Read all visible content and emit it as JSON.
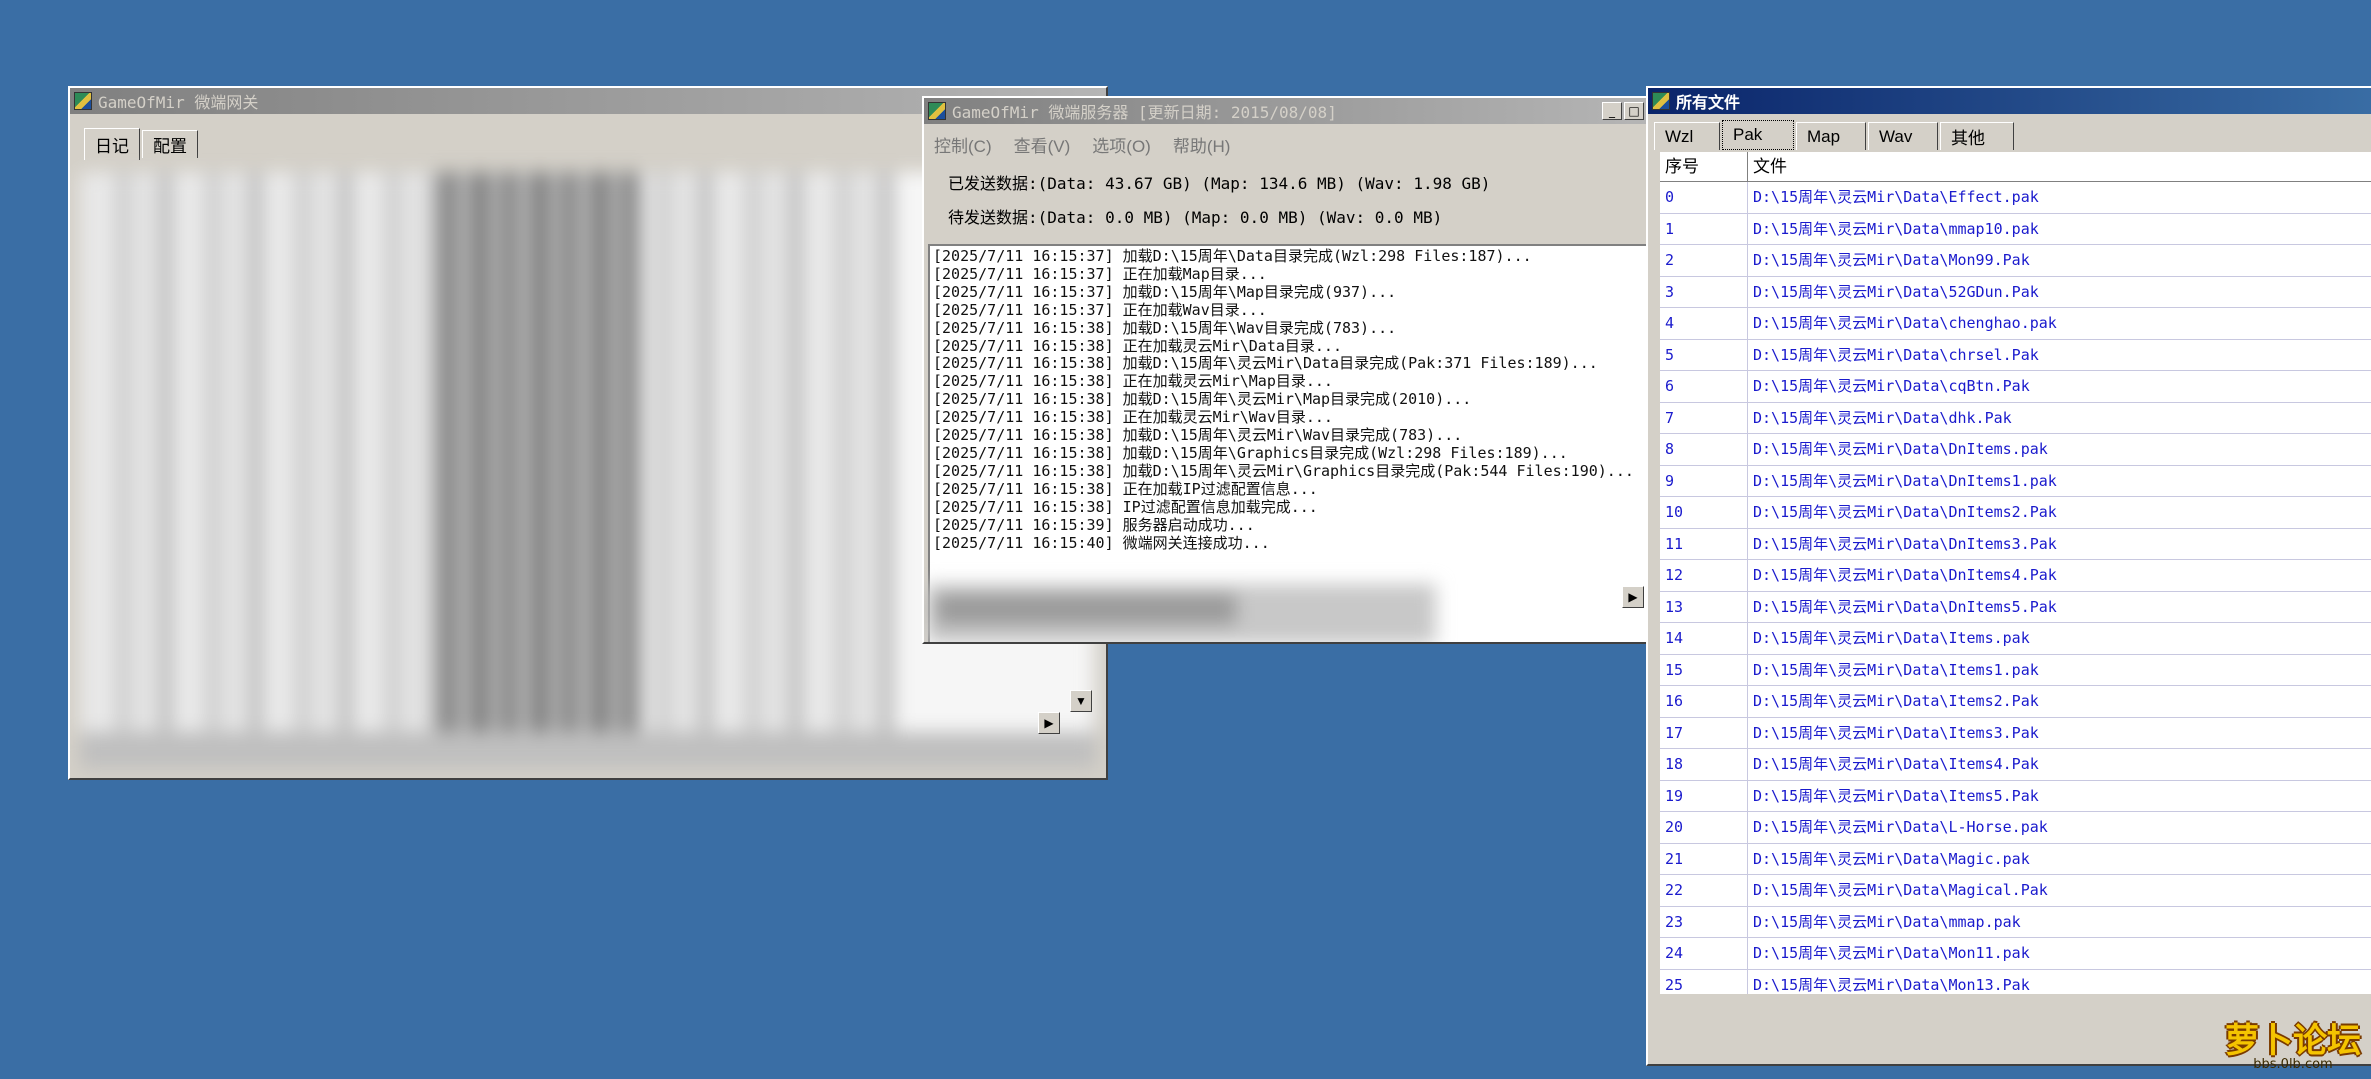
{
  "gateway_window": {
    "title": "GameOfMir 微端网关",
    "tabs": [
      "日记",
      "配置"
    ]
  },
  "server_window": {
    "title": "GameOfMir 微端服务器 [更新日期: 2015/08/08]",
    "menu": [
      "控制(C)",
      "查看(V)",
      "选项(O)",
      "帮助(H)"
    ],
    "sent_stats": "已发送数据:(Data: 43.67 GB) (Map: 134.6 MB) (Wav: 1.98 GB)",
    "pending_stats": "待发送数据:(Data: 0.0 MB) (Map: 0.0 MB) (Wav: 0.0 MB)",
    "log": [
      "[2025/7/11 16:15:37] 加载D:\\15周年\\Data目录完成(Wzl:298 Files:187)...",
      "[2025/7/11 16:15:37] 正在加载Map目录...",
      "[2025/7/11 16:15:37] 加载D:\\15周年\\Map目录完成(937)...",
      "[2025/7/11 16:15:37] 正在加载Wav目录...",
      "[2025/7/11 16:15:38] 加载D:\\15周年\\Wav目录完成(783)...",
      "[2025/7/11 16:15:38] 正在加载灵云Mir\\Data目录...",
      "[2025/7/11 16:15:38] 加载D:\\15周年\\灵云Mir\\Data目录完成(Pak:371 Files:189)...",
      "[2025/7/11 16:15:38] 正在加载灵云Mir\\Map目录...",
      "[2025/7/11 16:15:38] 加载D:\\15周年\\灵云Mir\\Map目录完成(2010)...",
      "[2025/7/11 16:15:38] 正在加载灵云Mir\\Wav目录...",
      "[2025/7/11 16:15:38] 加载D:\\15周年\\灵云Mir\\Wav目录完成(783)...",
      "[2025/7/11 16:15:38] 加载D:\\15周年\\Graphics目录完成(Wzl:298 Files:189)...",
      "[2025/7/11 16:15:38] 加载D:\\15周年\\灵云Mir\\Graphics目录完成(Pak:544 Files:190)...",
      "[2025/7/11 16:15:38] 正在加载IP过滤配置信息...",
      "[2025/7/11 16:15:38] IP过滤配置信息加载完成...",
      "[2025/7/11 16:15:39] 服务器启动成功...",
      "[2025/7/11 16:15:40] 微端网关连接成功..."
    ]
  },
  "files_window": {
    "title": "所有文件",
    "tabs": [
      "Wzl",
      "Pak",
      "Map",
      "Wav",
      "其他"
    ],
    "selected_tab": "Pak",
    "columns": [
      "序号",
      "文件"
    ],
    "rows": [
      {
        "index": "0",
        "file": "D:\\15周年\\灵云Mir\\Data\\Effect.pak"
      },
      {
        "index": "1",
        "file": "D:\\15周年\\灵云Mir\\Data\\mmap10.pak"
      },
      {
        "index": "2",
        "file": "D:\\15周年\\灵云Mir\\Data\\Mon99.Pak"
      },
      {
        "index": "3",
        "file": "D:\\15周年\\灵云Mir\\Data\\52GDun.Pak"
      },
      {
        "index": "4",
        "file": "D:\\15周年\\灵云Mir\\Data\\chenghao.pak"
      },
      {
        "index": "5",
        "file": "D:\\15周年\\灵云Mir\\Data\\chrsel.Pak"
      },
      {
        "index": "6",
        "file": "D:\\15周年\\灵云Mir\\Data\\cqBtn.Pak"
      },
      {
        "index": "7",
        "file": "D:\\15周年\\灵云Mir\\Data\\dhk.Pak"
      },
      {
        "index": "8",
        "file": "D:\\15周年\\灵云Mir\\Data\\DnItems.pak"
      },
      {
        "index": "9",
        "file": "D:\\15周年\\灵云Mir\\Data\\DnItems1.pak"
      },
      {
        "index": "10",
        "file": "D:\\15周年\\灵云Mir\\Data\\DnItems2.Pak"
      },
      {
        "index": "11",
        "file": "D:\\15周年\\灵云Mir\\Data\\DnItems3.Pak"
      },
      {
        "index": "12",
        "file": "D:\\15周年\\灵云Mir\\Data\\DnItems4.Pak"
      },
      {
        "index": "13",
        "file": "D:\\15周年\\灵云Mir\\Data\\DnItems5.Pak"
      },
      {
        "index": "14",
        "file": "D:\\15周年\\灵云Mir\\Data\\Items.pak"
      },
      {
        "index": "15",
        "file": "D:\\15周年\\灵云Mir\\Data\\Items1.pak"
      },
      {
        "index": "16",
        "file": "D:\\15周年\\灵云Mir\\Data\\Items2.Pak"
      },
      {
        "index": "17",
        "file": "D:\\15周年\\灵云Mir\\Data\\Items3.Pak"
      },
      {
        "index": "18",
        "file": "D:\\15周年\\灵云Mir\\Data\\Items4.Pak"
      },
      {
        "index": "19",
        "file": "D:\\15周年\\灵云Mir\\Data\\Items5.Pak"
      },
      {
        "index": "20",
        "file": "D:\\15周年\\灵云Mir\\Data\\L-Horse.pak"
      },
      {
        "index": "21",
        "file": "D:\\15周年\\灵云Mir\\Data\\Magic.pak"
      },
      {
        "index": "22",
        "file": "D:\\15周年\\灵云Mir\\Data\\Magical.Pak"
      },
      {
        "index": "23",
        "file": "D:\\15周年\\灵云Mir\\Data\\mmap.pak"
      },
      {
        "index": "24",
        "file": "D:\\15周年\\灵云Mir\\Data\\Mon11.pak"
      },
      {
        "index": "25",
        "file": "D:\\15周年\\灵云Mir\\Data\\Mon13.Pak"
      }
    ]
  },
  "watermark": {
    "main": "萝卜论坛",
    "sub": "bbs.0lb.com"
  },
  "icons": {
    "app": "game-app-icon",
    "minimize": "minimize-icon",
    "maximize": "maximize-icon",
    "scroll_down": "arrow-down-icon",
    "scroll_right": "arrow-right-icon"
  }
}
